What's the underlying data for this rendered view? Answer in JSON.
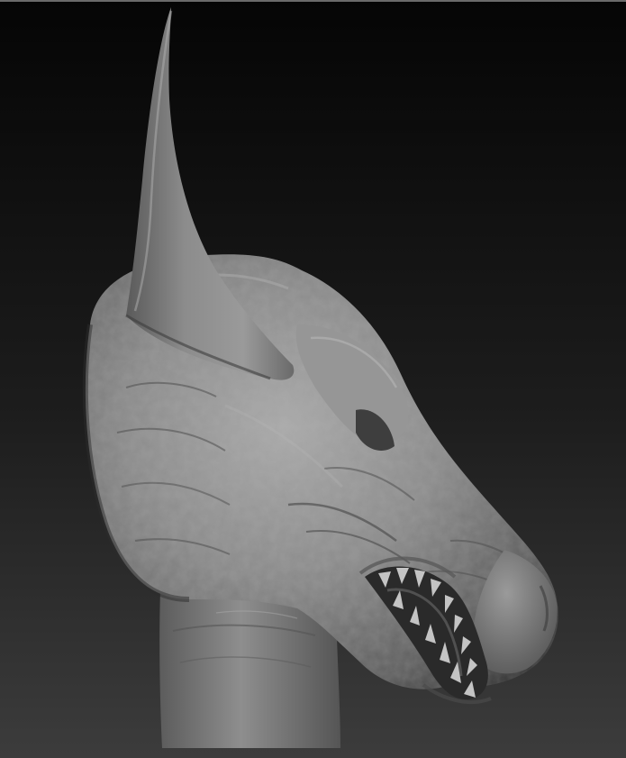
{
  "viewport": {
    "background_top": "#050505",
    "background_bottom": "#3a3a3a",
    "material_light": "#a8a8a8",
    "material_mid": "#7c7c7c",
    "material_dark": "#3a3a3a",
    "material_shadow": "#1e1e1e"
  },
  "subject": {
    "icon": "horned-creature-head-sculpt",
    "parts": [
      "horn",
      "head",
      "eye-ridge",
      "snout",
      "mouth",
      "teeth",
      "neck"
    ]
  }
}
